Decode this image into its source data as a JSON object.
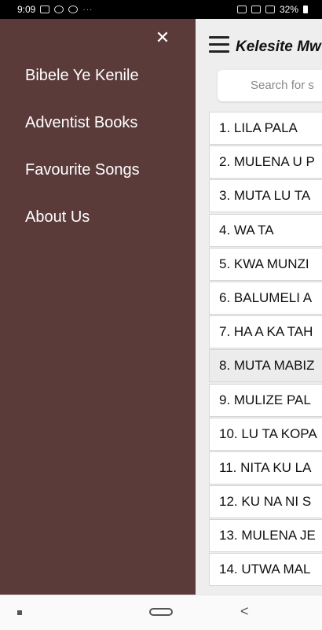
{
  "status_bar": {
    "time": "9:09",
    "icons_left": [
      "image-icon",
      "chat-icon",
      "message-icon"
    ],
    "more": "···",
    "icons_right": [
      "key-icon",
      "wifi-icon",
      "signal-icon"
    ],
    "battery": "32%"
  },
  "app": {
    "title": "Kelesite Mw",
    "search_placeholder": "Search for s",
    "songs": [
      "1. LILA PALA",
      "2. MULENA U P",
      "3. MUTA LU TA",
      "4. WA TA",
      "5. KWA MUNZI",
      "6. BALUMELI A",
      "7. HA A KA TAH",
      "8. MUTA MABIZ",
      "9. MULIZE PAL",
      "10. LU TA KOPA",
      "11. NITA KU LA",
      "12. KU NA NI S",
      "13. MULENA JE",
      "14. UTWA MAL"
    ]
  },
  "drawer": {
    "close_icon": "close-icon",
    "menu": [
      "Bibele Ye Kenile",
      "Adventist Books",
      "Favourite Songs",
      "About Us"
    ]
  },
  "colors": {
    "drawer_bg": "#5b3a3a",
    "app_bg": "#eeeeee",
    "selected_row": "#ececec"
  }
}
